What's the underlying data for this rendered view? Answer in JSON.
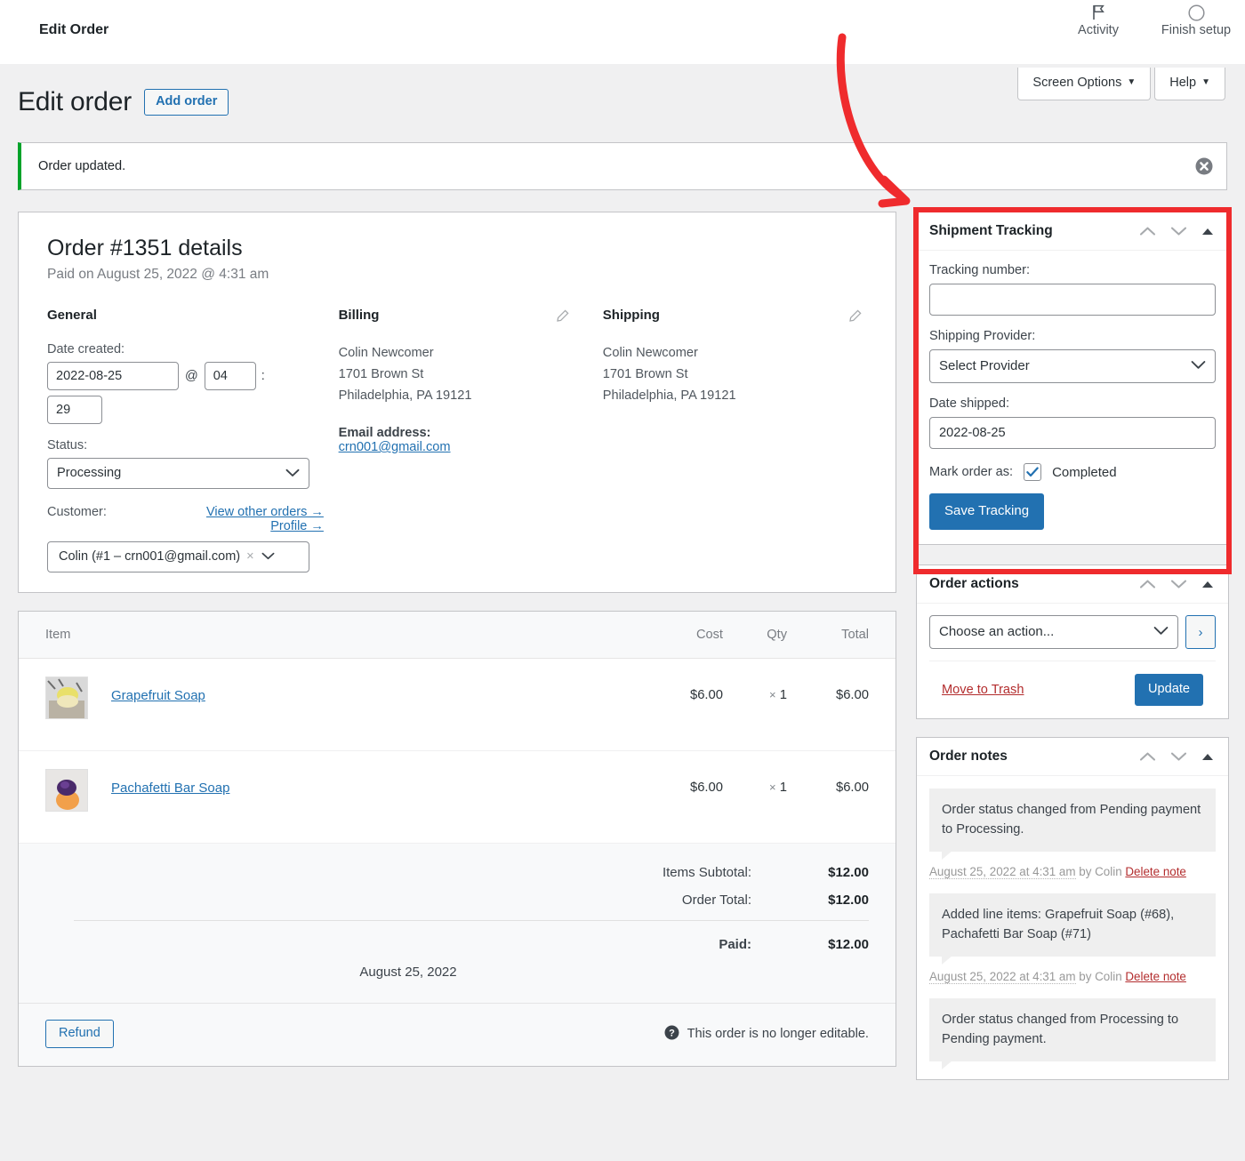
{
  "adminbar": {
    "title": "Edit Order",
    "items": [
      {
        "label": "Activity",
        "icon": "flag-icon"
      },
      {
        "label": "Finish setup",
        "icon": "circle-icon"
      }
    ]
  },
  "screen_meta": {
    "screen_options": "Screen Options",
    "help": "Help",
    "caret": "▼"
  },
  "page": {
    "title": "Edit order",
    "add_order": "Add order"
  },
  "notice": {
    "text": "Order updated.",
    "accent_color": "#00a32a"
  },
  "order": {
    "heading": "Order #1351 details",
    "subheading": "Paid on August 25, 2022 @ 4:31 am",
    "general": {
      "heading": "General",
      "date_created_label": "Date created:",
      "date_value": "2022-08-25",
      "at_symbol": "@",
      "hour_value": "04",
      "colon": ":",
      "minute_value": "29",
      "status_label": "Status:",
      "status_value": "Processing",
      "customer_label": "Customer:",
      "view_other_orders": "View other orders →",
      "profile": "Profile →",
      "customer_value": "Colin (#1 – crn001@gmail.com)",
      "customer_clear": "×"
    },
    "billing": {
      "heading": "Billing",
      "name": "Colin Newcomer",
      "street": "1701 Brown St",
      "city_state_zip": "Philadelphia, PA 19121",
      "email_label": "Email address:",
      "email": "crn001@gmail.com"
    },
    "shipping": {
      "heading": "Shipping",
      "name": "Colin Newcomer",
      "street": "1701 Brown St",
      "city_state_zip": "Philadelphia, PA 19121"
    }
  },
  "items": {
    "columns": {
      "item": "Item",
      "cost": "Cost",
      "qty": "Qty",
      "total": "Total"
    },
    "rows": [
      {
        "name": "Grapefruit Soap",
        "cost": "$6.00",
        "qty": "1",
        "qty_prefix": "×",
        "total": "$6.00",
        "thumb": "grapefruit-soap-thumbnail"
      },
      {
        "name": "Pachafetti Bar Soap",
        "cost": "$6.00",
        "qty": "1",
        "qty_prefix": "×",
        "total": "$6.00",
        "thumb": "pachafetti-bar-soap-thumbnail"
      }
    ],
    "totals": [
      {
        "label": "Items Subtotal:",
        "value": "$12.00",
        "bold": false
      },
      {
        "label": "Order Total:",
        "value": "$12.00",
        "bold": false
      }
    ],
    "paid_label": "Paid:",
    "paid_value": "$12.00",
    "paid_date": "August 25, 2022",
    "refund_label": "Refund",
    "not_editable": "This order is no longer editable."
  },
  "tracking": {
    "panel_title": "Shipment Tracking",
    "tracking_number_label": "Tracking number:",
    "tracking_number_value": "",
    "tracking_number_placeholder": "",
    "provider_label": "Shipping Provider:",
    "provider_value": "Select Provider",
    "date_shipped_label": "Date shipped:",
    "date_shipped_value": "2022-08-25",
    "mark_order_label": "Mark order as:",
    "mark_order_value": "Completed",
    "mark_order_checked": true,
    "save_button": "Save Tracking",
    "highlight_color": "#ef2b2d"
  },
  "order_actions": {
    "panel_title": "Order actions",
    "action_value": "Choose an action...",
    "go_label": "›",
    "move_to_trash": "Move to Trash",
    "update": "Update"
  },
  "order_notes": {
    "panel_title": "Order notes",
    "notes": [
      {
        "text": "Order status changed from Pending payment to Processing.",
        "timestamp": "August 25, 2022 at 4:31 am",
        "by": "by Colin",
        "delete": "Delete note"
      },
      {
        "text": "Added line items: Grapefruit Soap (#68), Pachafetti Bar Soap (#71)",
        "timestamp": "August 25, 2022 at 4:31 am",
        "by": "by Colin",
        "delete": "Delete note"
      },
      {
        "text": "Order status changed from Processing to Pending payment.",
        "timestamp": "",
        "by": "",
        "delete": ""
      }
    ]
  }
}
